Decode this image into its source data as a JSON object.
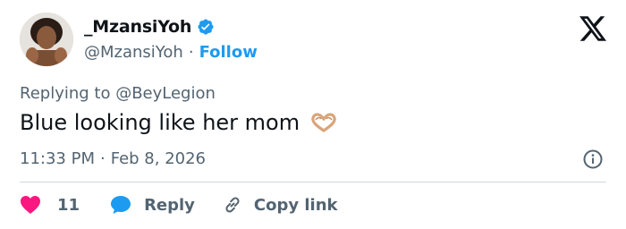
{
  "author": {
    "display_name": "_MzansiYoh",
    "handle": "@MzansiYoh",
    "separator": "·",
    "follow_label": "Follow"
  },
  "tweet": {
    "replying_to": "Replying to @BeyLegion",
    "text": "Blue looking like her mom",
    "emoji": "heart-hands",
    "time": "11:33 PM",
    "date_separator": "·",
    "date": "Feb 8, 2026"
  },
  "actions": {
    "like_count": "11",
    "reply_label": "Reply",
    "copy_label": "Copy link"
  },
  "colors": {
    "accent": "#1d9bf0",
    "like": "#f91880",
    "text": "#0f1419",
    "muted": "#536471",
    "divider": "#cfd9de"
  },
  "icons": [
    "avatar",
    "verified-badge-icon",
    "x-logo-icon",
    "heart-hands-emoji",
    "info-icon",
    "heart-icon",
    "reply-bubble-icon",
    "link-icon"
  ]
}
